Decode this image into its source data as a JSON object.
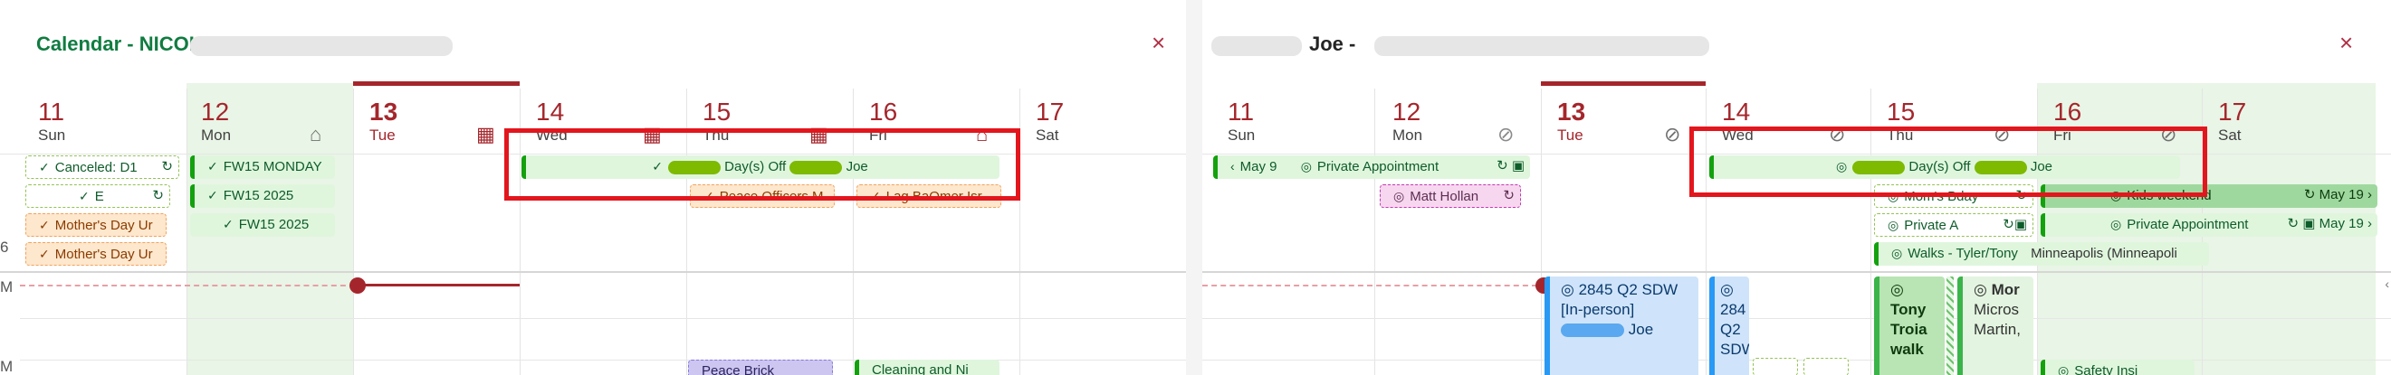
{
  "left": {
    "title": "Calendar - NICOLE",
    "close_glyph": "×",
    "days": [
      {
        "num": "11",
        "name": "Sun"
      },
      {
        "num": "12",
        "name": "Mon"
      },
      {
        "num": "13",
        "name": "Tue"
      },
      {
        "num": "14",
        "name": "Wed"
      },
      {
        "num": "15",
        "name": "Thu"
      },
      {
        "num": "16",
        "name": "Fri"
      },
      {
        "num": "17",
        "name": "Sat"
      }
    ],
    "day_icons": [
      "home-icon",
      "building-icon",
      "building-icon",
      "building-icon",
      "home-icon"
    ],
    "events": {
      "canceled": "Canceled: D1",
      "e_event": "E",
      "mothers_day_1": "Mother's Day Ur",
      "mothers_day_2": "Mother's Day Ur",
      "fw15_monday": "FW15 MONDAY",
      "fw15_2025_a": "FW15 2025",
      "fw15_2025_b": "FW15 2025",
      "days_off": "Day(s) Off",
      "days_off_name": "Joe",
      "peace_officers": "Peace Officers M",
      "lag_baomer": "Lag BaOmer Isr",
      "thu_bottom": "Peace Brick",
      "fri_bottom": "Cleaning and Ni"
    },
    "time_labels": [
      "6",
      "M",
      "M"
    ]
  },
  "right": {
    "title": "Joe -",
    "close_glyph": "×",
    "days": [
      {
        "num": "11",
        "name": "Sun"
      },
      {
        "num": "12",
        "name": "Mon"
      },
      {
        "num": "13",
        "name": "Tue"
      },
      {
        "num": "14",
        "name": "Wed"
      },
      {
        "num": "15",
        "name": "Thu"
      },
      {
        "num": "16",
        "name": "Fri"
      },
      {
        "num": "17",
        "name": "Sat"
      }
    ],
    "events": {
      "may9": "May 9",
      "private_appt": "Private Appointment",
      "matt": "Matt Hollan",
      "days_off": "Day(s) Off",
      "days_off_name": "Joe",
      "moms_bday": "Mom's Bday",
      "private_a": "Private A",
      "walks": "Walks - Tyler/Tony",
      "walks_location": "Minneapolis (Minneapoli",
      "kids_weekend": "Kids weekend",
      "may19_a": "May 19",
      "private_appt2": "Private Appointment",
      "may19_b": "May 19",
      "q2_title": "2845 Q2 SDW [In-person]",
      "q2_name": "Joe",
      "q2_col2_line1": "284",
      "q2_col2_line2": "Q2",
      "q2_col2_line3": "SDW",
      "tony_line1": "Tony",
      "tony_line2": "Troia",
      "tony_line3": "walk",
      "mor_line1": "Mor",
      "mor_line2": "Micros",
      "mor_line3": "Martin,",
      "safety": "Safety Insi"
    }
  },
  "colors": {
    "accent_red": "#a4262c",
    "highlight_red": "#e3161d",
    "green_event": "#13a10e",
    "blue_event": "#2899f5"
  }
}
